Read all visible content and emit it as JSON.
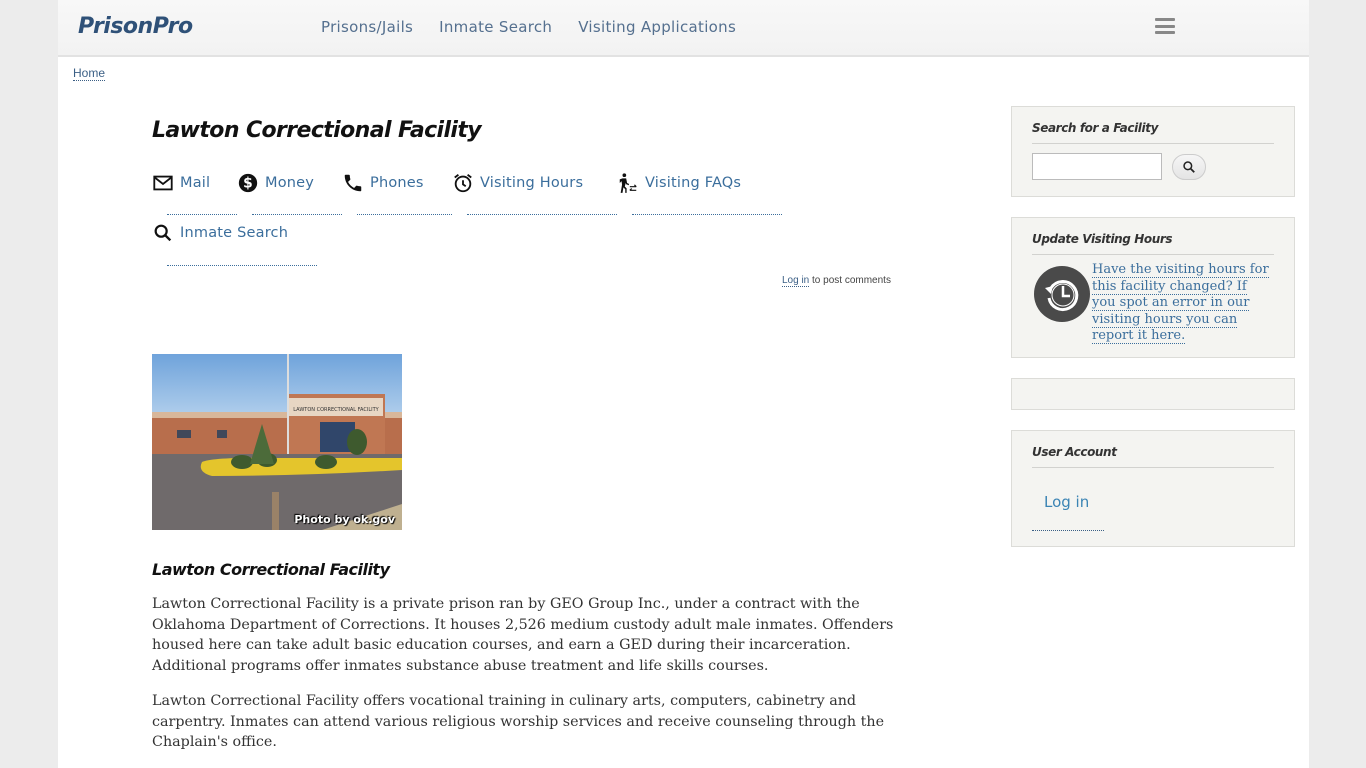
{
  "header": {
    "logo": "PrisonPro",
    "nav": [
      "Prisons/Jails",
      "Inmate Search",
      "Visiting Applications"
    ],
    "menu_icon": "hamburger-menu-icon"
  },
  "breadcrumb": {
    "home": "Home"
  },
  "main": {
    "title": "Lawton Correctional Facility",
    "tabs": [
      {
        "label": "Mail",
        "icon": "mail-icon"
      },
      {
        "label": "Money",
        "icon": "dollar-circle-icon"
      },
      {
        "label": "Phones",
        "icon": "phone-icon"
      },
      {
        "label": "Visiting Hours",
        "icon": "alarm-clock-icon"
      },
      {
        "label": "Visiting FAQs",
        "icon": "walking-person-icon"
      },
      {
        "label": "Inmate Search",
        "icon": "search-icon"
      }
    ],
    "comment_login": "Log in",
    "comment_suffix": " to post comments",
    "photo_credit": "Photo by ok.gov",
    "photo_sign": "LAWTON CORRECTIONAL FACILITY",
    "subtitle": "Lawton Correctional Facility",
    "paragraphs": [
      "Lawton Correctional Facility is a private prison ran by GEO Group Inc., under a contract with the Oklahoma Department of Corrections.  It houses 2,526 medium custody adult male inmates.  Offenders housed here can take adult basic education courses, and earn a GED during their incarceration.  Additional programs offer inmates substance abuse treatment and life skills courses.",
      "Lawton Correctional Facility offers vocational training in culinary arts, computers, cabinetry and carpentry.  Inmates can attend various religious worship services and receive counseling through the Chaplain's office."
    ]
  },
  "sidebar": {
    "search": {
      "title": "Search for a Facility",
      "value": "",
      "placeholder": ""
    },
    "update_hours": {
      "title": "Update Visiting Hours",
      "link": "Have the visiting hours for this facility changed?  If you spot an error in our visiting hours you can report it here."
    },
    "user_account": {
      "title": "User Account",
      "login": "Log in"
    }
  }
}
